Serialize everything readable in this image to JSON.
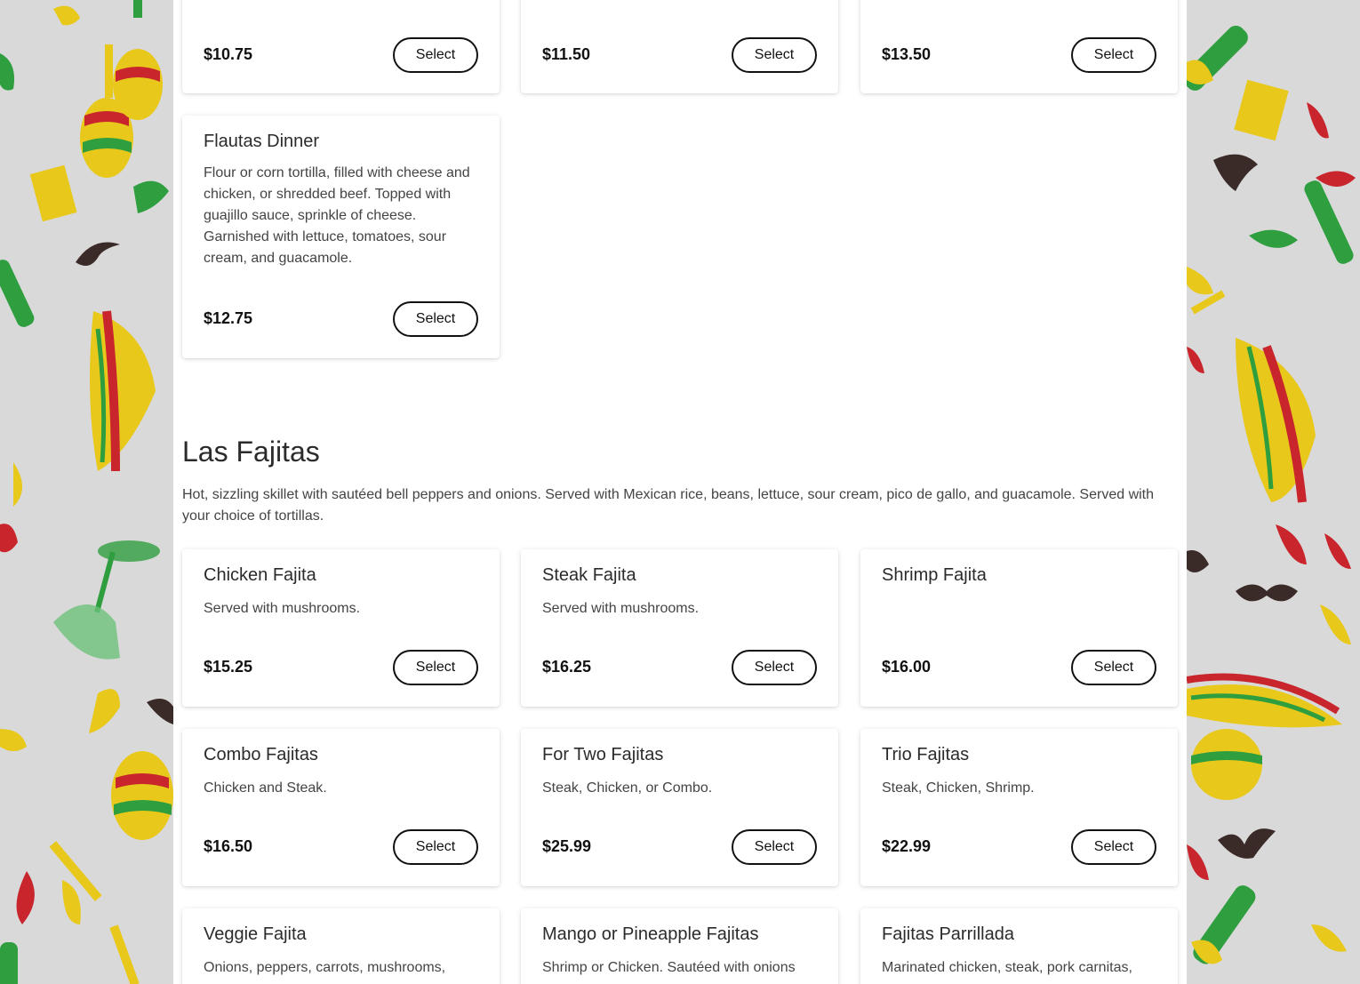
{
  "top_row": [
    {
      "price": "$10.75",
      "select_label": "Select"
    },
    {
      "price": "$11.50",
      "select_label": "Select"
    },
    {
      "price": "$13.50",
      "select_label": "Select"
    }
  ],
  "flautas": {
    "name": "Flautas Dinner",
    "description": "Flour or corn tortilla, filled with cheese and chicken, or shredded beef. Topped with guajillo sauce, sprinkle of cheese. Garnished with lettuce, tomatoes, sour cream, and guacamole.",
    "price": "$12.75",
    "select_label": "Select"
  },
  "fajitas_section": {
    "title": "Las Fajitas",
    "description": "Hot, sizzling skillet with sautéed bell peppers and onions. Served with Mexican rice, beans, lettuce, sour cream, pico de gallo, and guacamole. Served with your choice of tortillas.",
    "items": [
      {
        "name": "Chicken Fajita",
        "description": "Served with mushrooms.",
        "price": "$15.25",
        "select_label": "Select"
      },
      {
        "name": "Steak Fajita",
        "description": "Served with mushrooms.",
        "price": "$16.25",
        "select_label": "Select"
      },
      {
        "name": "Shrimp Fajita",
        "description": "",
        "price": "$16.00",
        "select_label": "Select"
      },
      {
        "name": "Combo Fajitas",
        "description": "Chicken and Steak.",
        "price": "$16.50",
        "select_label": "Select"
      },
      {
        "name": "For Two Fajitas",
        "description": "Steak, Chicken, or Combo.",
        "price": "$25.99",
        "select_label": "Select"
      },
      {
        "name": "Trio Fajitas",
        "description": "Steak, Chicken, Shrimp.",
        "price": "$22.99",
        "select_label": "Select"
      },
      {
        "name": "Veggie Fajita",
        "description": "Onions, peppers, carrots, mushrooms,",
        "price": "",
        "select_label": ""
      },
      {
        "name": "Mango or Pineapple Fajitas",
        "description": "Shrimp or Chicken. Sautéed with onions",
        "price": "",
        "select_label": ""
      },
      {
        "name": "Fajitas Parrillada",
        "description": "Marinated chicken, steak, pork carnitas,",
        "price": "",
        "select_label": ""
      }
    ]
  },
  "colors": {
    "background_pattern": "#d9d9d9",
    "content_bg": "#ffffff",
    "button_border": "#111111",
    "pepper_red": "#c8262c",
    "pepper_green": "#2e9e3f",
    "pepper_yellow": "#e8c81a",
    "mustache": "#3a2a28"
  },
  "icons": [
    "chili-pepper-icon",
    "mustache-icon",
    "sombrero-icon",
    "maraca-icon",
    "cactus-icon",
    "cheese-icon",
    "margarita-glass-icon"
  ]
}
